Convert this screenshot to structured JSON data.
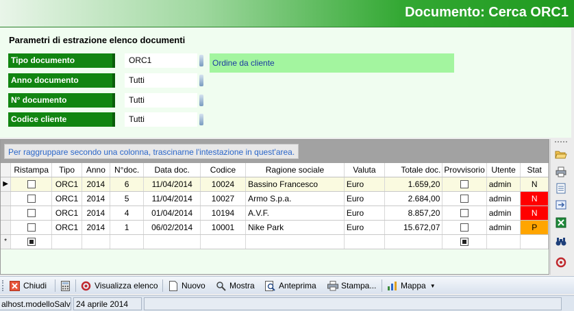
{
  "header": {
    "title": "Documento: Cerca ORC1"
  },
  "params": {
    "title": "Parametri di estrazione elenco documenti",
    "rows": [
      {
        "label": "Tipo documento",
        "value": "ORC1"
      },
      {
        "label": "Anno documento",
        "value": "Tutti"
      },
      {
        "label": "N° documento",
        "value": "Tutti"
      },
      {
        "label": "Codice cliente",
        "value": "Tutti"
      }
    ],
    "tipo_description": "Ordine da cliente"
  },
  "grid": {
    "group_hint": "Per raggruppare secondo una colonna, trascinarne l'intestazione in quest'area.",
    "columns": [
      "Ristampa",
      "Tipo",
      "Anno",
      "N°doc.",
      "Data doc.",
      "Codice",
      "Ragione sociale",
      "Valuta",
      "Totale doc.",
      "Provvisorio",
      "Utente",
      "Stat"
    ],
    "rows": [
      {
        "ristampa": false,
        "tipo": "ORC1",
        "anno": "2014",
        "ndoc": "6",
        "data": "11/04/2014",
        "codice": "10024",
        "ragione": "Bassino Francesco",
        "valuta": "Euro",
        "totale": "1.659,20",
        "provvisorio": false,
        "utente": "admin",
        "stat": "N",
        "stat_color": "none",
        "selected": true
      },
      {
        "ristampa": false,
        "tipo": "ORC1",
        "anno": "2014",
        "ndoc": "5",
        "data": "11/04/2014",
        "codice": "10027",
        "ragione": "Armo S.p.a.",
        "valuta": "Euro",
        "totale": "2.684,00",
        "provvisorio": false,
        "utente": "admin",
        "stat": "N",
        "stat_color": "#ff0000",
        "selected": false
      },
      {
        "ristampa": false,
        "tipo": "ORC1",
        "anno": "2014",
        "ndoc": "4",
        "data": "01/04/2014",
        "codice": "10194",
        "ragione": "A.V.F.",
        "valuta": "Euro",
        "totale": "8.857,20",
        "provvisorio": false,
        "utente": "admin",
        "stat": "N",
        "stat_color": "#ff0000",
        "selected": false
      },
      {
        "ristampa": false,
        "tipo": "ORC1",
        "anno": "2014",
        "ndoc": "1",
        "data": "06/02/2014",
        "codice": "10001",
        "ragione": "Nike Park",
        "valuta": "Euro",
        "totale": "15.672,07",
        "provvisorio": false,
        "utente": "admin",
        "stat": "P",
        "stat_color": "#ffa500",
        "selected": false
      }
    ],
    "new_row_marker": "*",
    "current_row_marker": "▶"
  },
  "right_toolbar": {
    "icons": [
      "open-folder-icon",
      "print-icon",
      "document-icon",
      "export-icon",
      "excel-icon",
      "binoculars-icon",
      "refresh-icon"
    ]
  },
  "toolbar": {
    "close_label": "Chiudi",
    "visualizza_label": "Visualizza elenco",
    "nuovo_label": "Nuovo",
    "mostra_label": "Mostra",
    "anteprima_label": "Anteprima",
    "stampa_label": "Stampa...",
    "mappa_label": "Mappa"
  },
  "status": {
    "left": "alhost.modelloSalva",
    "date": "24 aprile 2014",
    "extra": ""
  }
}
